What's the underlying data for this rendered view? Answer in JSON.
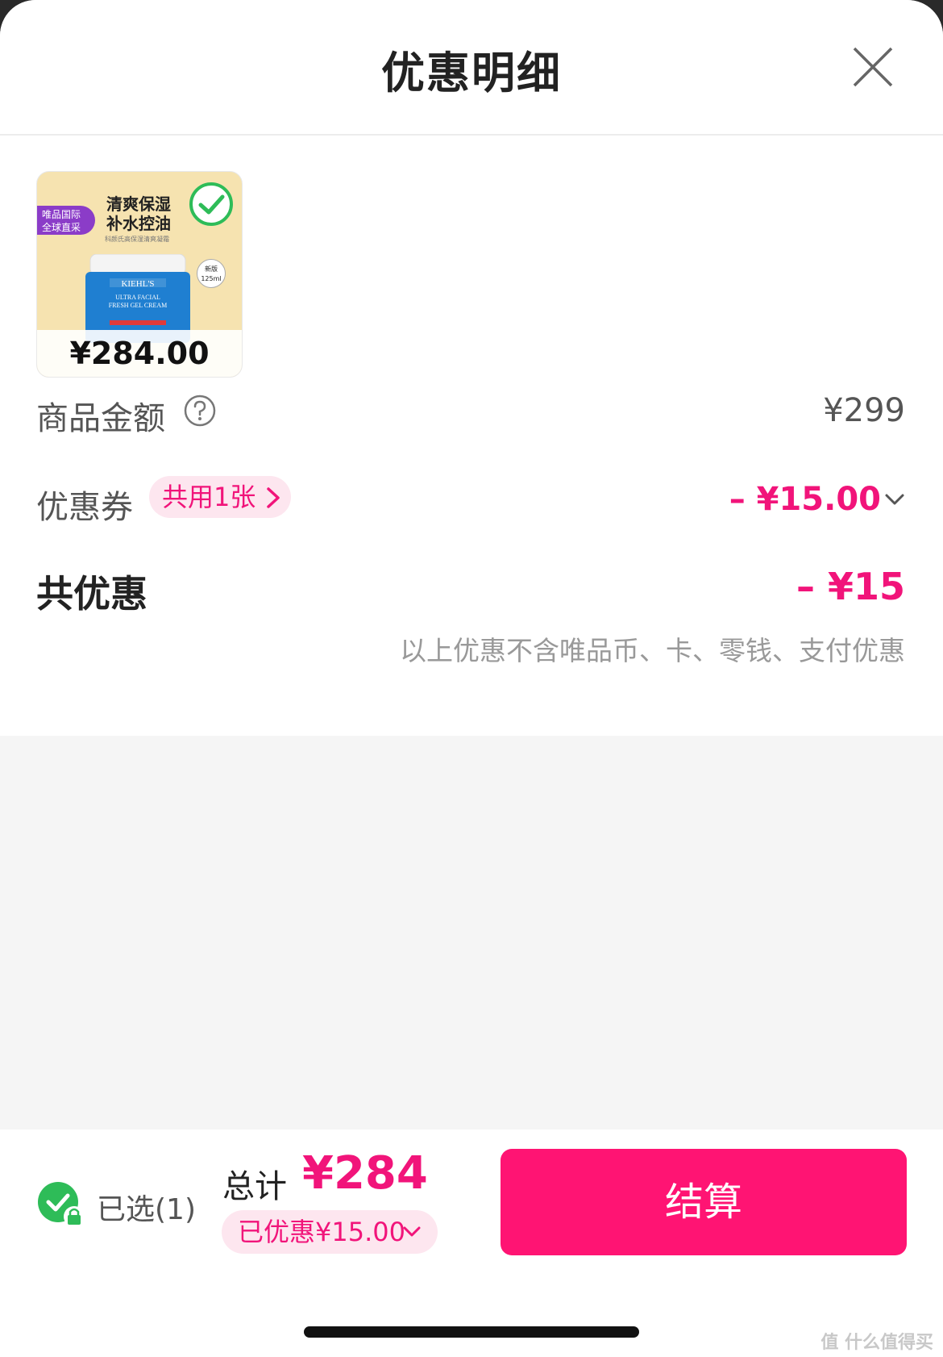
{
  "header": {
    "title": "优惠明细"
  },
  "product": {
    "price": "¥284.00",
    "badge_line1": "唯品国际",
    "badge_line2": "全球直采",
    "slogan_line1": "清爽保湿",
    "slogan_line2": "补水控油",
    "slogan_sub": "科颜氏高保湿清爽凝霜",
    "brand": "KIEHL'S",
    "product_name_line1": "ULTRA FACIAL",
    "product_name_line2": "FRESH GEL CREAM",
    "volume_line1": "新版",
    "volume_line2": "125ml"
  },
  "summary": {
    "goods_amount_label": "商品金额",
    "goods_amount_value": "¥299",
    "coupon_label": "优惠券",
    "coupon_chip": "共用1张",
    "coupon_value": "– ¥15.00",
    "total_discount_label": "共优惠",
    "total_discount_value": "– ¥15",
    "note": "以上优惠不含唯品币、卡、零钱、支付优惠"
  },
  "bottom": {
    "selected_label": "已选(1)",
    "total_label": "总计",
    "total_value": "¥284",
    "saved_label": "已优惠¥15.00",
    "checkout_label": "结算"
  },
  "watermark": "值 什么值得买",
  "colors": {
    "accent": "#f1147a",
    "button": "#ff1473",
    "chip_bg": "#fde6ef",
    "check_green": "#2ebc58"
  },
  "icons": [
    "close-icon",
    "check-circle-icon",
    "help-icon",
    "chevron-right-icon",
    "chevron-down-icon",
    "lock-icon"
  ]
}
